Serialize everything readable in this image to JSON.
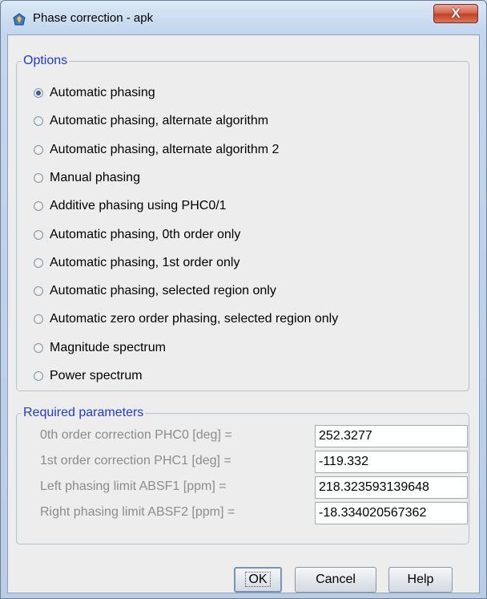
{
  "window": {
    "title": "Phase correction - apk",
    "close_label": "X"
  },
  "options": {
    "legend": "Options",
    "items": [
      {
        "label": "Automatic phasing",
        "checked": true
      },
      {
        "label": "Automatic phasing, alternate algorithm",
        "checked": false
      },
      {
        "label": "Automatic phasing, alternate algorithm 2",
        "checked": false
      },
      {
        "label": "Manual phasing",
        "checked": false
      },
      {
        "label": "Additive phasing using PHC0/1",
        "checked": false
      },
      {
        "label": "Automatic phasing, 0th order only",
        "checked": false
      },
      {
        "label": "Automatic phasing, 1st order only",
        "checked": false
      },
      {
        "label": "Automatic phasing, selected region only",
        "checked": false
      },
      {
        "label": "Automatic zero order phasing, selected region only",
        "checked": false
      },
      {
        "label": "Magnitude spectrum",
        "checked": false
      },
      {
        "label": "Power spectrum",
        "checked": false
      }
    ]
  },
  "params": {
    "legend": "Required parameters",
    "items": [
      {
        "label": "0th order correction PHC0 [deg] =",
        "value": "252.3277"
      },
      {
        "label": "1st order correction PHC1 [deg] =",
        "value": "-119.332"
      },
      {
        "label": "Left phasing limit ABSF1 [ppm] =",
        "value": "218.323593139648"
      },
      {
        "label": "Right phasing limit ABSF2 [ppm] =",
        "value": "-18.334020567362"
      }
    ]
  },
  "buttons": {
    "ok": "OK",
    "cancel": "Cancel",
    "help": "Help"
  }
}
